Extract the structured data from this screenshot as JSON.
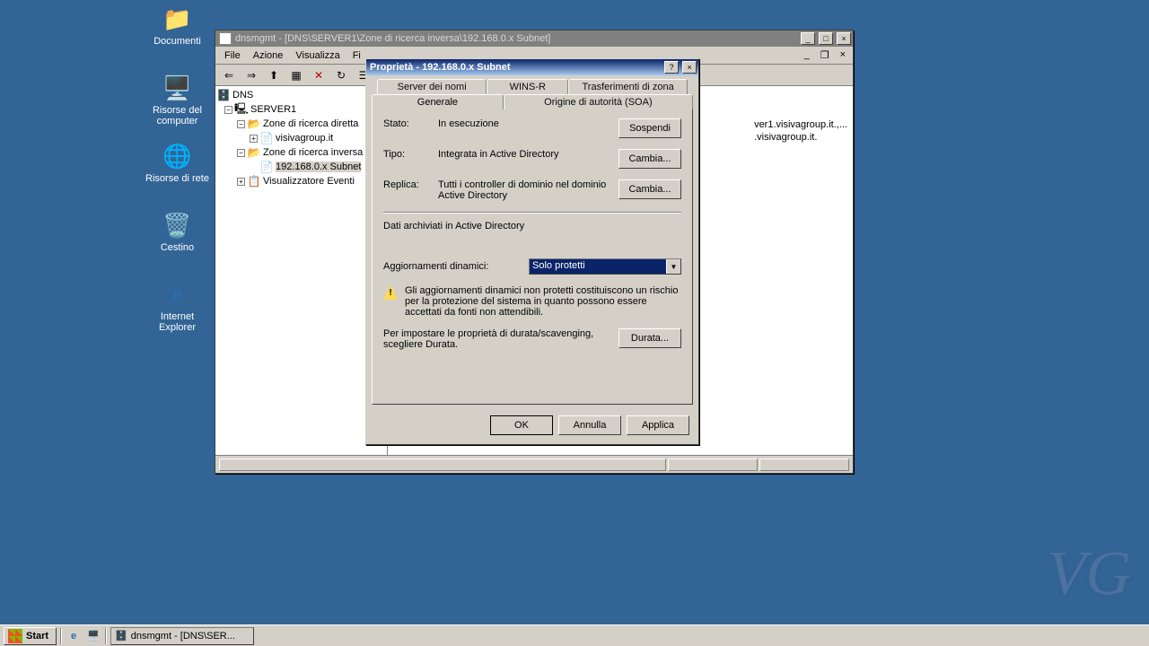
{
  "desktop": {
    "icons": [
      {
        "label": "Documenti",
        "glyph": "📁"
      },
      {
        "label": "Risorse del computer",
        "glyph": "🖥️"
      },
      {
        "label": "Risorse di rete",
        "glyph": "🌐"
      },
      {
        "label": "Cestino",
        "glyph": "🗑️"
      },
      {
        "label": "Internet Explorer",
        "glyph": "e"
      }
    ]
  },
  "mmc": {
    "title": "dnsmgmt - [DNS\\SERVER1\\Zone di ricerca inversa\\192.168.0.x Subnet]",
    "menu": {
      "file": "File",
      "azione": "Azione",
      "visualizza": "Visualizza",
      "finestra": "Fi"
    },
    "tree": {
      "root": "DNS",
      "server": "SERVER1",
      "fwd": "Zone di ricerca diretta",
      "fwd1": "visivagroup.it",
      "rev": "Zone di ricerca inversa",
      "rev1": "192.168.0.x Subnet",
      "viewer": "Visualizzatore Eventi"
    },
    "content": {
      "line1": "ver1.visivagroup.it.,...",
      "line2": ".visivagroup.it."
    }
  },
  "dialog": {
    "title": "Proprietà - 192.168.0.x Subnet",
    "tabs": {
      "back": [
        "Server dei nomi",
        "WINS-R",
        "Trasferimenti di zona"
      ],
      "front": [
        "Generale",
        "Origine di autorità (SOA)"
      ]
    },
    "stato_label": "Stato:",
    "stato_value": "In esecuzione",
    "sospendi": "Sospendi",
    "tipo_label": "Tipo:",
    "tipo_value": "Integrata in Active Directory",
    "cambia": "Cambia...",
    "replica_label": "Replica:",
    "replica_value": "Tutti i controller di dominio nel dominio Active Directory",
    "archiviati": "Dati archiviati in Active Directory",
    "aggiornamenti_label": "Aggiornamenti dinamici:",
    "aggiornamenti_value": "Solo protetti",
    "warn_text": "Gli aggiornamenti dinamici non protetti costituiscono un rischio per la protezione del sistema in quanto possono essere accettati da fonti non attendibili.",
    "durata_text": "Per impostare le proprietà di durata/scavenging, scegliere Durata.",
    "durata_btn": "Durata...",
    "ok": "OK",
    "annulla": "Annulla",
    "applica": "Applica"
  },
  "taskbar": {
    "start": "Start",
    "task1": "dnsmgmt - [DNS\\SER..."
  }
}
